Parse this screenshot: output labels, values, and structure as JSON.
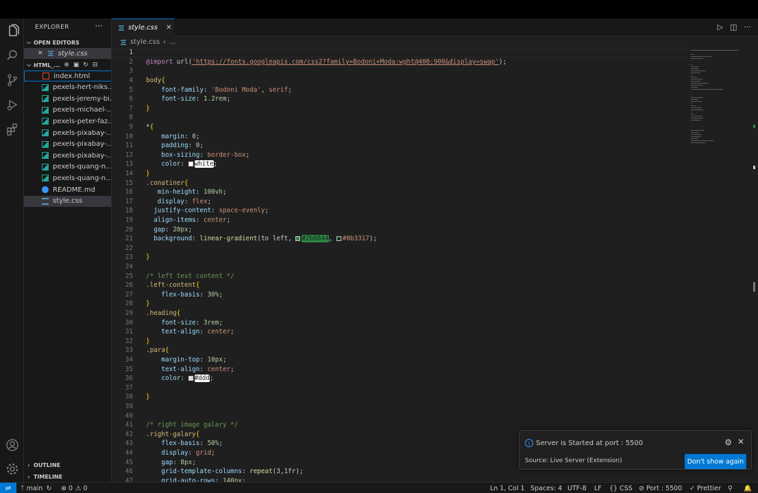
{
  "explorer": {
    "title": "EXPLORER",
    "more": "···",
    "open_editors_label": "OPEN EDITORS",
    "open_editor_file": "style.css",
    "folder_label": "HTML_...",
    "files": [
      {
        "name": "index.html",
        "type": "html"
      },
      {
        "name": "pexels-hert-niks...",
        "type": "image"
      },
      {
        "name": "pexels-jeremy-bi...",
        "type": "image"
      },
      {
        "name": "pexels-michael-...",
        "type": "image"
      },
      {
        "name": "pexels-peter-faz...",
        "type": "image"
      },
      {
        "name": "pexels-pixabay-...",
        "type": "image"
      },
      {
        "name": "pexels-pixabay-...",
        "type": "image"
      },
      {
        "name": "pexels-pixabay-...",
        "type": "image"
      },
      {
        "name": "pexels-quang-n...",
        "type": "image"
      },
      {
        "name": "pexels-quang-n...",
        "type": "image"
      },
      {
        "name": "README.md",
        "type": "info"
      },
      {
        "name": "style.css",
        "type": "css"
      }
    ],
    "outline_label": "OUTLINE",
    "timeline_label": "TIMELINE"
  },
  "tab": {
    "label": "style.css",
    "close": "✕"
  },
  "breadcrumb": {
    "file": "style.css",
    "rest": "..."
  },
  "editor": {
    "cursor_line": 1,
    "lines": [
      {
        "n": "1",
        "t": [
          {
            "c": "",
            "k": "p"
          }
        ]
      },
      {
        "n": "2",
        "t": [
          {
            "c": "@import",
            "k": "kw"
          },
          {
            "c": " url(",
            "k": "p"
          },
          {
            "c": "'https://fonts.googleapis.com/css2?family=Bodoni+Moda:wght@400;900&display=swap'",
            "k": "url"
          },
          {
            "c": ");",
            "k": "p"
          }
        ]
      },
      {
        "n": "3",
        "t": []
      },
      {
        "n": "4",
        "t": [
          {
            "c": "body",
            "k": "sel"
          },
          {
            "c": "{",
            "k": "br"
          }
        ]
      },
      {
        "n": "5",
        "t": [
          {
            "c": "    font-family",
            "k": "prop"
          },
          {
            "c": ": ",
            "k": "p"
          },
          {
            "c": "'Bodoni Moda'",
            "k": "str"
          },
          {
            "c": ", ",
            "k": "p"
          },
          {
            "c": "serif",
            "k": "str"
          },
          {
            "c": ";",
            "k": "p"
          }
        ]
      },
      {
        "n": "6",
        "t": [
          {
            "c": "    font-size",
            "k": "prop"
          },
          {
            "c": ": ",
            "k": "p"
          },
          {
            "c": "1.2rem",
            "k": "num"
          },
          {
            "c": ";",
            "k": "p"
          }
        ]
      },
      {
        "n": "7",
        "t": [
          {
            "c": "}",
            "k": "br"
          }
        ]
      },
      {
        "n": "8",
        "t": []
      },
      {
        "n": "9",
        "t": [
          {
            "c": "*",
            "k": "sel2"
          },
          {
            "c": "{",
            "k": "br"
          }
        ]
      },
      {
        "n": "10",
        "t": [
          {
            "c": "    margin",
            "k": "prop"
          },
          {
            "c": ": ",
            "k": "p"
          },
          {
            "c": "0",
            "k": "num"
          },
          {
            "c": ";",
            "k": "p"
          }
        ]
      },
      {
        "n": "11",
        "t": [
          {
            "c": "    padding",
            "k": "prop"
          },
          {
            "c": ": ",
            "k": "p"
          },
          {
            "c": "0",
            "k": "num"
          },
          {
            "c": ";",
            "k": "p"
          }
        ]
      },
      {
        "n": "12",
        "t": [
          {
            "c": "    box-sizing",
            "k": "prop"
          },
          {
            "c": ": ",
            "k": "p"
          },
          {
            "c": "border-box",
            "k": "str"
          },
          {
            "c": ";",
            "k": "p"
          }
        ]
      },
      {
        "n": "13",
        "t": [
          {
            "c": "    color",
            "k": "prop"
          },
          {
            "c": ": ",
            "k": "p"
          },
          {
            "c": "#ffffff",
            "k": "swatch"
          },
          {
            "c": "white",
            "k": "hl"
          },
          {
            "c": ";",
            "k": "p"
          }
        ]
      },
      {
        "n": "14",
        "t": [
          {
            "c": "}",
            "k": "br"
          }
        ]
      },
      {
        "n": "15",
        "t": [
          {
            "c": ".conatiner",
            "k": "sel"
          },
          {
            "c": "{",
            "k": "br"
          }
        ]
      },
      {
        "n": "16",
        "t": [
          {
            "c": "   min-height",
            "k": "prop"
          },
          {
            "c": ": ",
            "k": "p"
          },
          {
            "c": "100vh",
            "k": "num"
          },
          {
            "c": ";",
            "k": "p"
          }
        ]
      },
      {
        "n": "17",
        "t": [
          {
            "c": "   display",
            "k": "prop"
          },
          {
            "c": ": ",
            "k": "p"
          },
          {
            "c": "flex",
            "k": "str"
          },
          {
            "c": ";",
            "k": "p"
          }
        ]
      },
      {
        "n": "18",
        "t": [
          {
            "c": "  justify-content",
            "k": "prop"
          },
          {
            "c": ": ",
            "k": "p"
          },
          {
            "c": "space-evenly",
            "k": "str"
          },
          {
            "c": ";",
            "k": "p"
          }
        ]
      },
      {
        "n": "19",
        "t": [
          {
            "c": "  align-items",
            "k": "prop"
          },
          {
            "c": ": ",
            "k": "p"
          },
          {
            "c": "center",
            "k": "str"
          },
          {
            "c": ";",
            "k": "p"
          }
        ]
      },
      {
        "n": "20",
        "t": [
          {
            "c": "  gap",
            "k": "prop"
          },
          {
            "c": ": ",
            "k": "p"
          },
          {
            "c": "20px",
            "k": "num"
          },
          {
            "c": ";",
            "k": "p"
          }
        ]
      },
      {
        "n": "21",
        "t": [
          {
            "c": "  background",
            "k": "prop"
          },
          {
            "c": ": ",
            "k": "p"
          },
          {
            "c": "linear-gradient",
            "k": "fn"
          },
          {
            "c": "(to left, ",
            "k": "p"
          },
          {
            "c": "#2b8844",
            "k": "swatch"
          },
          {
            "c": "#2b8844",
            "k": "hlg"
          },
          {
            "c": ", ",
            "k": "p"
          },
          {
            "c": "#0b3317",
            "k": "swatch"
          },
          {
            "c": "#0b3317",
            "k": "str"
          },
          {
            "c": ");",
            "k": "p"
          }
        ]
      },
      {
        "n": "22",
        "t": []
      },
      {
        "n": "23",
        "t": [
          {
            "c": "}",
            "k": "br"
          }
        ]
      },
      {
        "n": "24",
        "t": []
      },
      {
        "n": "25",
        "t": [
          {
            "c": "/* left text content */",
            "k": "cm"
          }
        ]
      },
      {
        "n": "26",
        "t": [
          {
            "c": ".left-content",
            "k": "sel"
          },
          {
            "c": "{",
            "k": "br"
          }
        ]
      },
      {
        "n": "27",
        "t": [
          {
            "c": "    flex-basis",
            "k": "prop"
          },
          {
            "c": ": ",
            "k": "p"
          },
          {
            "c": "30%",
            "k": "num"
          },
          {
            "c": ";",
            "k": "p"
          }
        ]
      },
      {
        "n": "28",
        "t": [
          {
            "c": "}",
            "k": "br"
          }
        ]
      },
      {
        "n": "29",
        "t": [
          {
            "c": ".heading",
            "k": "sel"
          },
          {
            "c": "{",
            "k": "br"
          }
        ]
      },
      {
        "n": "30",
        "t": [
          {
            "c": "    font-size",
            "k": "prop"
          },
          {
            "c": ": ",
            "k": "p"
          },
          {
            "c": "3rem",
            "k": "num"
          },
          {
            "c": ";",
            "k": "p"
          }
        ]
      },
      {
        "n": "31",
        "t": [
          {
            "c": "    text-align",
            "k": "prop"
          },
          {
            "c": ": ",
            "k": "p"
          },
          {
            "c": "center",
            "k": "str"
          },
          {
            "c": ";",
            "k": "p"
          }
        ]
      },
      {
        "n": "32",
        "t": [
          {
            "c": "}",
            "k": "br"
          }
        ]
      },
      {
        "n": "33",
        "t": [
          {
            "c": ".para",
            "k": "sel"
          },
          {
            "c": "{",
            "k": "br"
          }
        ]
      },
      {
        "n": "34",
        "t": [
          {
            "c": "    margin-top",
            "k": "prop"
          },
          {
            "c": ": ",
            "k": "p"
          },
          {
            "c": "10px",
            "k": "num"
          },
          {
            "c": ";",
            "k": "p"
          }
        ]
      },
      {
        "n": "35",
        "t": [
          {
            "c": "    text-align",
            "k": "prop"
          },
          {
            "c": ": ",
            "k": "p"
          },
          {
            "c": "center",
            "k": "str"
          },
          {
            "c": ";",
            "k": "p"
          }
        ]
      },
      {
        "n": "36",
        "t": [
          {
            "c": "    color",
            "k": "prop"
          },
          {
            "c": ": ",
            "k": "p"
          },
          {
            "c": "#dddddd",
            "k": "swatch"
          },
          {
            "c": "#ddd",
            "k": "hl"
          },
          {
            "c": ";",
            "k": "p"
          }
        ]
      },
      {
        "n": "37",
        "t": []
      },
      {
        "n": "38",
        "t": [
          {
            "c": "}",
            "k": "br"
          }
        ]
      },
      {
        "n": "39",
        "t": []
      },
      {
        "n": "40",
        "t": []
      },
      {
        "n": "41",
        "t": [
          {
            "c": "/* right image galary */",
            "k": "cm"
          }
        ]
      },
      {
        "n": "42",
        "t": [
          {
            "c": ".right-galary",
            "k": "sel"
          },
          {
            "c": "{",
            "k": "br"
          }
        ]
      },
      {
        "n": "43",
        "t": [
          {
            "c": "    flex-basis",
            "k": "prop"
          },
          {
            "c": ": ",
            "k": "p"
          },
          {
            "c": "50%",
            "k": "num"
          },
          {
            "c": ";",
            "k": "p"
          }
        ]
      },
      {
        "n": "44",
        "t": [
          {
            "c": "    display",
            "k": "prop"
          },
          {
            "c": ": ",
            "k": "p"
          },
          {
            "c": "grid",
            "k": "str"
          },
          {
            "c": ";",
            "k": "p"
          }
        ]
      },
      {
        "n": "45",
        "t": [
          {
            "c": "    gap",
            "k": "prop"
          },
          {
            "c": ": ",
            "k": "p"
          },
          {
            "c": "8px",
            "k": "num"
          },
          {
            "c": ";",
            "k": "p"
          }
        ]
      },
      {
        "n": "46",
        "t": [
          {
            "c": "    grid-template-columns",
            "k": "prop"
          },
          {
            "c": ": ",
            "k": "p"
          },
          {
            "c": "repeat",
            "k": "fn"
          },
          {
            "c": "(3,1fr);",
            "k": "p"
          }
        ]
      },
      {
        "n": "47",
        "t": [
          {
            "c": "    grid-auto-rows",
            "k": "prop"
          },
          {
            "c": ": ",
            "k": "p"
          },
          {
            "c": "140px",
            "k": "num"
          },
          {
            "c": ";",
            "k": "p"
          }
        ]
      }
    ]
  },
  "notification": {
    "message": "Server is Started at port : 5500",
    "source": "Source: Live Server (Extension)",
    "button": "Don't show again"
  },
  "status": {
    "branch": "main",
    "errors": "0",
    "warnings": "0",
    "position": "Ln 1, Col 1",
    "spaces": "Spaces: 4",
    "encoding": "UTF-8",
    "eol": "LF",
    "language": "CSS",
    "port": "Port : 5500",
    "prettier": "Prettier"
  },
  "colors": {
    "accent": "#0078d4",
    "selector": "#d7ba7d",
    "property": "#9cdcfe",
    "string": "#ce9178",
    "number": "#b5cea8",
    "comment": "#6a9955",
    "keyword": "#c586c0",
    "function": "#dcdcaa",
    "brace": "#ffd700"
  }
}
